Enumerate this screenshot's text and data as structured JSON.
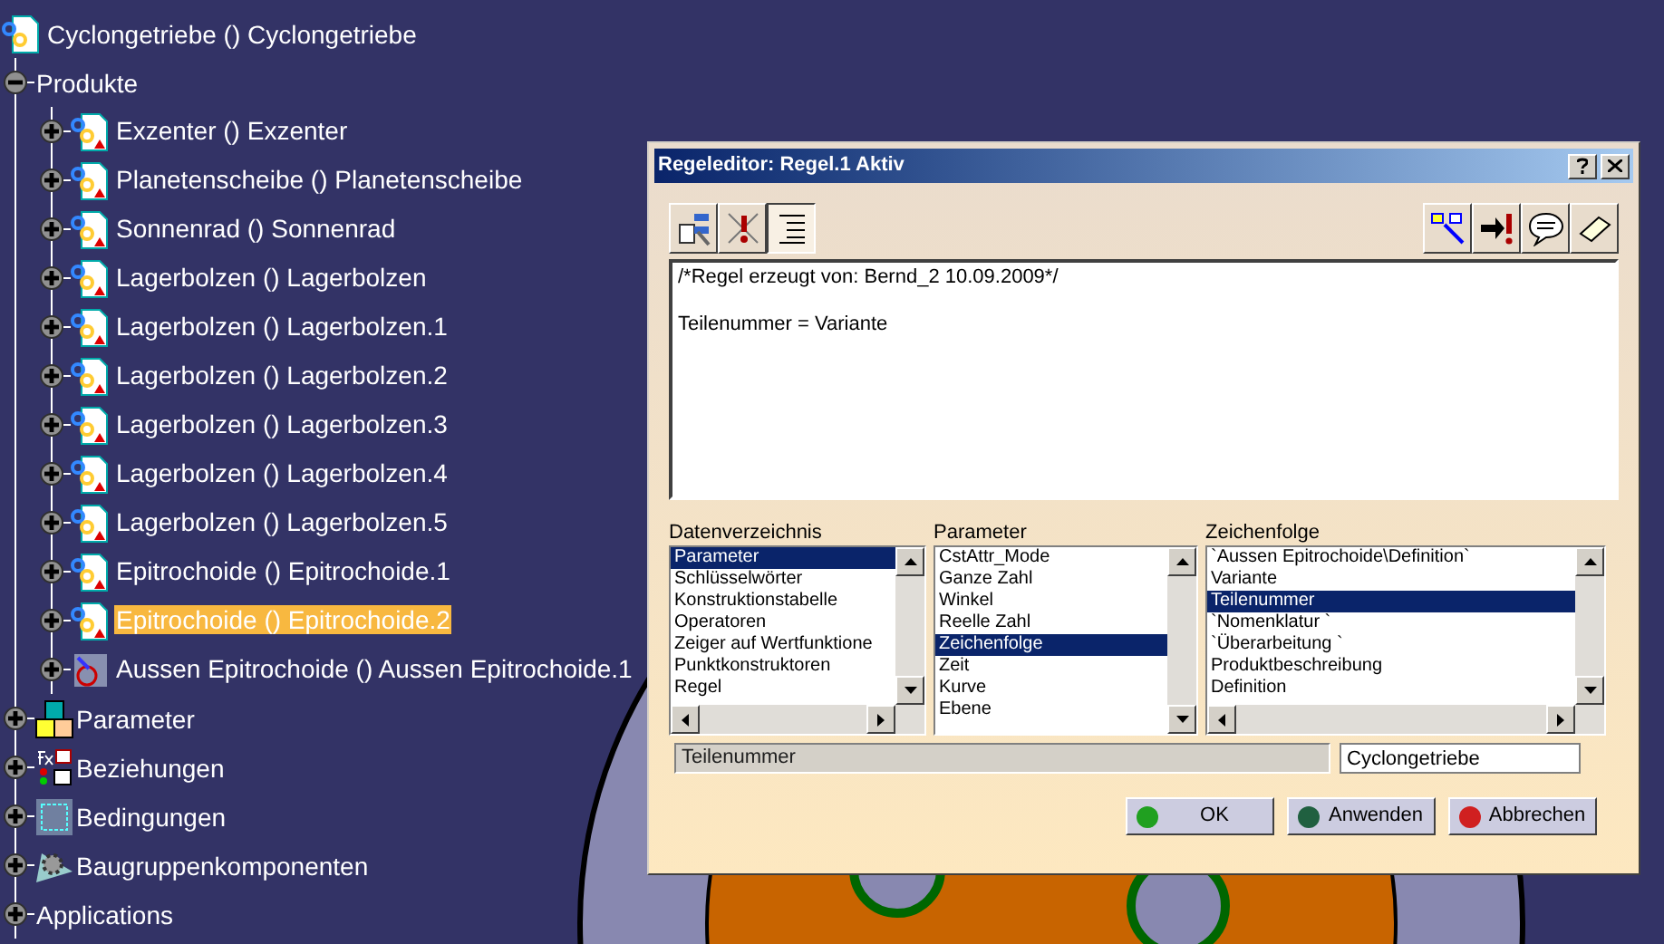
{
  "tree": {
    "root": {
      "label": "Cyclongetriebe () Cyclongetriebe"
    },
    "children": [
      {
        "label": "Produkte",
        "kind": "folder",
        "expanded": true,
        "children": [
          {
            "label": "Exzenter () Exzenter",
            "kind": "part",
            "expanded": false,
            "selected": false
          },
          {
            "label": "Planetenscheibe () Planetenscheibe",
            "kind": "part",
            "expanded": false,
            "selected": false
          },
          {
            "label": "Sonnenrad () Sonnenrad",
            "kind": "part",
            "expanded": false,
            "selected": false
          },
          {
            "label": "Lagerbolzen () Lagerbolzen",
            "kind": "part",
            "expanded": false,
            "selected": false
          },
          {
            "label": "Lagerbolzen () Lagerbolzen.1",
            "kind": "part",
            "expanded": false,
            "selected": false
          },
          {
            "label": "Lagerbolzen () Lagerbolzen.2",
            "kind": "part",
            "expanded": false,
            "selected": false
          },
          {
            "label": "Lagerbolzen () Lagerbolzen.3",
            "kind": "part",
            "expanded": false,
            "selected": false
          },
          {
            "label": "Lagerbolzen () Lagerbolzen.4",
            "kind": "part",
            "expanded": false,
            "selected": false
          },
          {
            "label": "Lagerbolzen () Lagerbolzen.5",
            "kind": "part",
            "expanded": false,
            "selected": false
          },
          {
            "label": "Epitrochoide () Epitrochoide.1",
            "kind": "part",
            "expanded": false,
            "selected": false
          },
          {
            "label": "Epitrochoide () Epitrochoide.2",
            "kind": "part",
            "expanded": false,
            "selected": true
          },
          {
            "label": "Aussen Epitrochoide () Aussen Epitrochoide.1",
            "kind": "shape",
            "expanded": false,
            "selected": false
          }
        ]
      },
      {
        "label": "Parameter",
        "kind": "parameters",
        "expanded": false
      },
      {
        "label": "Beziehungen",
        "kind": "relations",
        "expanded": false
      },
      {
        "label": "Bedingungen",
        "kind": "constraints",
        "expanded": false
      },
      {
        "label": "Baugruppenkomponenten",
        "kind": "components",
        "expanded": false
      },
      {
        "label": "Applications",
        "kind": "folder",
        "expanded": false
      }
    ]
  },
  "dialog": {
    "title": "Regeleditor: Regel.1 Aktiv",
    "toolbar_left": [
      {
        "kind": "tree",
        "pressed": false
      },
      {
        "kind": "errors",
        "pressed": false
      },
      {
        "kind": "indent",
        "pressed": true
      }
    ],
    "toolbar_right": [
      {
        "kind": "wizard"
      },
      {
        "kind": "run"
      },
      {
        "kind": "comment"
      },
      {
        "kind": "eraser"
      }
    ],
    "editor_lines": [
      "/*Regel erzeugt von: Bernd_2 10.09.2009*/",
      "Teilenummer = Variante"
    ],
    "lists": [
      {
        "heading": "Datenverzeichnis",
        "items": [
          {
            "label": "Parameter",
            "selected": true
          },
          {
            "label": "Schlüsselwörter",
            "selected": false
          },
          {
            "label": "Konstruktionstabelle",
            "selected": false
          },
          {
            "label": "Operatoren",
            "selected": false
          },
          {
            "label": "Zeiger auf Wertfunktione",
            "selected": false
          },
          {
            "label": "Punktkonstruktoren",
            "selected": false
          },
          {
            "label": "Regel",
            "selected": false
          }
        ],
        "hscroll": true
      },
      {
        "heading": "Parameter",
        "items": [
          {
            "label": "CstAttr_Mode",
            "selected": false
          },
          {
            "label": "Ganze Zahl",
            "selected": false
          },
          {
            "label": "Winkel",
            "selected": false
          },
          {
            "label": "Reelle Zahl",
            "selected": false
          },
          {
            "label": "Zeichenfolge",
            "selected": true
          },
          {
            "label": "Zeit",
            "selected": false
          },
          {
            "label": "Kurve",
            "selected": false
          },
          {
            "label": "Ebene",
            "selected": false
          }
        ],
        "hscroll": false
      },
      {
        "heading": "Zeichenfolge",
        "items": [
          {
            "label": "`Aussen Epitrochoide\\Definition`",
            "selected": false
          },
          {
            "label": "Variante",
            "selected": false
          },
          {
            "label": "Teilenummer",
            "selected": true
          },
          {
            "label": "`Nomenklatur `",
            "selected": false
          },
          {
            "label": "`Überarbeitung `",
            "selected": false
          },
          {
            "label": "Produktbeschreibung",
            "selected": false
          },
          {
            "label": "Definition",
            "selected": false
          }
        ],
        "hscroll": true
      }
    ],
    "status_field": "Teilenummer",
    "value_field": "Cyclongetriebe",
    "buttons": [
      {
        "label": "OK",
        "color": "#20a020"
      },
      {
        "label": "Anwenden",
        "color": "#206040"
      },
      {
        "label": "Abbrechen",
        "color": "#d02020"
      }
    ]
  }
}
